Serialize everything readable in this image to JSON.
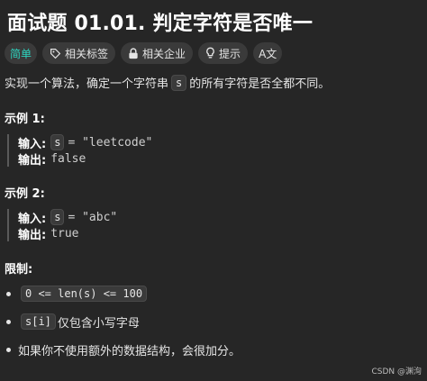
{
  "title": "面试题 01.01. 判定字符是否唯一",
  "tags": {
    "difficulty": "简单",
    "related_tags": "相关标签",
    "related_companies": "相关企业",
    "hints": "提示",
    "translate": "A文"
  },
  "description": {
    "before": "实现一个算法，确定一个字符串",
    "code": "s",
    "after": "的所有字符是否全都不同。"
  },
  "example1": {
    "title": "示例 1:",
    "input_label": "输入:",
    "input_var": "s",
    "input_value": "= \"leetcode\"",
    "output_label": "输出:",
    "output_value": "false"
  },
  "example2": {
    "title": "示例 2:",
    "input_label": "输入:",
    "input_var": "s",
    "input_value": "= \"abc\"",
    "output_label": "输出:",
    "output_value": "true"
  },
  "constraints": {
    "title": "限制:",
    "item1_code": "0 <= len(s) <= 100",
    "item2_code": "s[i]",
    "item2_text": "仅包含小写字母",
    "item3_text": "如果你不使用额外的数据结构，会很加分。"
  },
  "watermark": "CSDN @渊洵",
  "colors": {
    "background": "#262626",
    "difficulty_easy": "#2dd4bf",
    "tag_bg": "#3a3a3a"
  }
}
